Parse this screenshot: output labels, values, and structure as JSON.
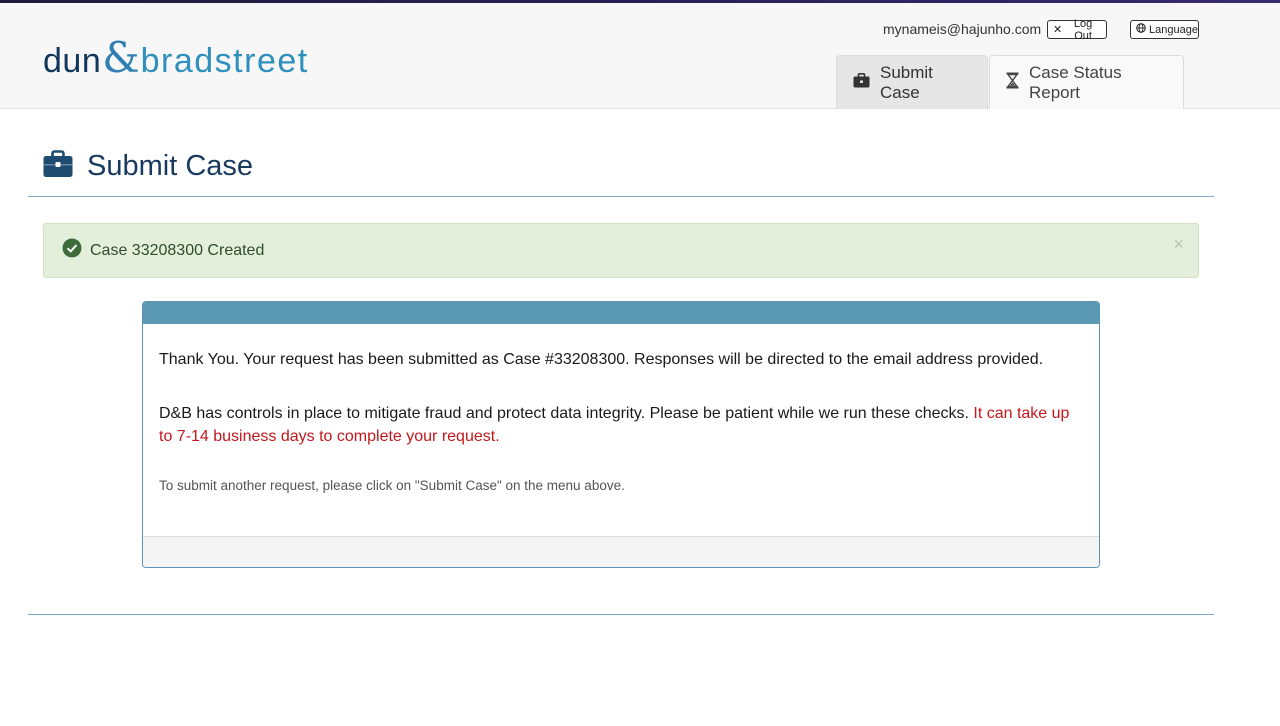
{
  "header": {
    "logo": {
      "part1": "dun",
      "amp": "&",
      "part2": "bradstreet"
    },
    "user_email": "mynameis@hajunho.com",
    "logout_label": "Log Out",
    "language_label": "Language",
    "tabs": [
      {
        "label": "Submit Case",
        "icon": "briefcase-icon",
        "active": true
      },
      {
        "label": "Case Status Report",
        "icon": "hourglass-icon",
        "active": false
      }
    ]
  },
  "page": {
    "title": "Submit Case",
    "title_icon": "briefcase-icon"
  },
  "alert": {
    "text": "Case 33208300 Created",
    "icon": "check-circle-icon",
    "close": "×"
  },
  "panel": {
    "message1": "Thank You. Your request has been submitted as Case #33208300. Responses will be directed to the email address provided.",
    "message2_normal": "D&B has controls in place to mitigate fraud and protect data integrity. Please be patient while we run these checks. ",
    "message2_warning": "It can take up to 7-14 business days to complete your request.",
    "message3": "To submit another request, please click on \"Submit Case\" on the menu above."
  },
  "colors": {
    "brand_navy": "#173a5e",
    "brand_blue": "#2f8fbd",
    "panel_header": "#5b98b4",
    "alert_bg": "#e3eedb",
    "warning_red": "#c4171c"
  }
}
